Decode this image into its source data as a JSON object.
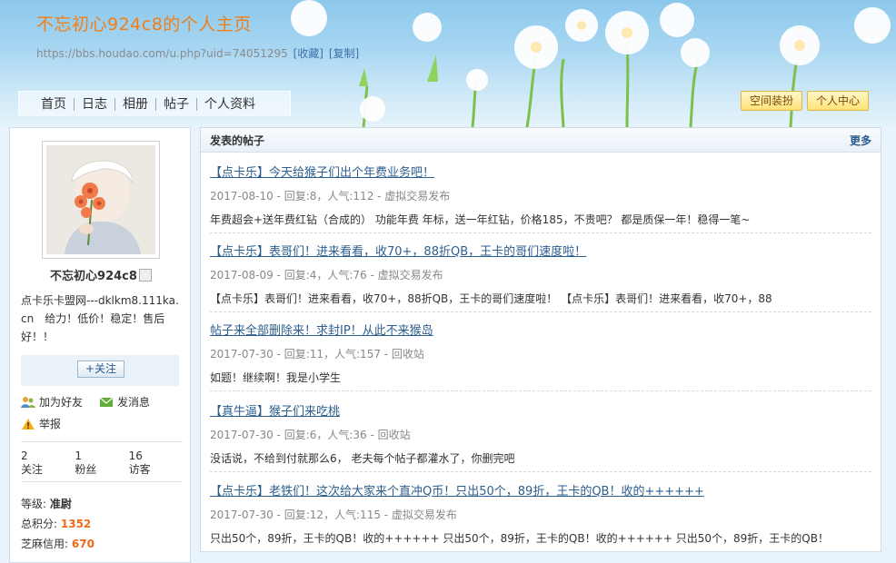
{
  "header": {
    "title": "不忘初心924c8的个人主页",
    "url": "https://bbs.houdao.com/u.php?uid=74051295",
    "links": [
      "[收藏]",
      "[复制]"
    ],
    "nav": [
      "首页",
      "日志",
      "相册",
      "帖子",
      "个人资料"
    ],
    "buttons": [
      "空间装扮",
      "个人中心"
    ]
  },
  "profile": {
    "username": "不忘初心924c8",
    "bio": "点卡乐卡盟网---dklkm8.111ka.cn　给力！低价！稳定！售后好！！",
    "follow_label": "+关注",
    "actions": [
      "加为好友",
      "发消息",
      "举报"
    ],
    "stats": [
      {
        "value": "2",
        "label": "关注"
      },
      {
        "value": "1",
        "label": "粉丝"
      },
      {
        "value": "16",
        "label": "访客"
      }
    ],
    "level_label": "等级:",
    "level_value": "准尉",
    "points_label": "总积分:",
    "points_value": "1352",
    "credit_label": "芝麻信用:",
    "credit_value": "670"
  },
  "posts_panel": {
    "title": "发表的帖子",
    "more": "更多",
    "posts": [
      {
        "title": "【点卡乐】今天给猴子们出个年费业务吧！",
        "meta": "2017-08-10 - 回复:8，人气:112 - 虚拟交易发布",
        "summary": "年费超会+送年费红钻（合成的） 功能年费 年标，送一年红钻，价格185，不贵吧？ 都是质保一年！稳得一笔~"
      },
      {
        "title": "【点卡乐】表哥们！进来看看，收70+，88折QB，王卡的哥们速度啦！",
        "meta": "2017-08-09 - 回复:4，人气:76 - 虚拟交易发布",
        "summary": "【点卡乐】表哥们！进来看看，收70+，88折QB，王卡的哥们速度啦！ 【点卡乐】表哥们！进来看看，收70+，88"
      },
      {
        "title": "帖子来全部删除来！求封IP！从此不来猴岛",
        "meta": "2017-07-30 - 回复:11，人气:157 - 回收站",
        "summary": "如题！继续啊！我是小学生"
      },
      {
        "title": "【真牛逼】猴子们来吃桃",
        "meta": "2017-07-30 - 回复:6，人气:36 - 回收站",
        "summary": "没话说，不给到付就那么6， 老夫每个帖子都灌水了，你删完吧"
      },
      {
        "title": "【点卡乐】老铁们！这次给大家来个直冲Q币！只出50个，89折，王卡的QB！收的++++++",
        "meta": "2017-07-30 - 回复:12，人气:115 - 虚拟交易发布",
        "summary": "只出50个，89折，王卡的QB！收的++++++ 只出50个，89折，王卡的QB！收的++++++ 只出50个，89折，王卡的QB！"
      }
    ]
  }
}
